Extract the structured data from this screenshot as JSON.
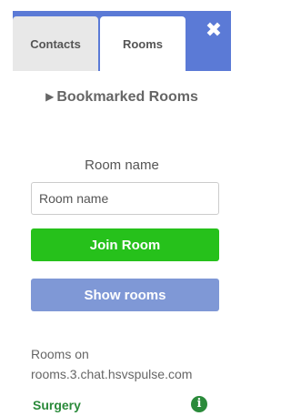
{
  "tabs": {
    "contacts_label": "Contacts",
    "rooms_label": "Rooms",
    "close_symbol": "✖"
  },
  "bookmarks": {
    "caret": "▶",
    "label": "Bookmarked Rooms"
  },
  "join_form": {
    "room_name_label": "Room name",
    "room_name_placeholder": "Room name",
    "room_name_value": "",
    "join_button_label": "Join Room",
    "show_rooms_label": "Show rooms"
  },
  "rooms_list": {
    "heading_line1": "Rooms on",
    "heading_line2": "rooms.3.chat.hsvspulse.com",
    "items": [
      {
        "name": "Surgery",
        "icon": "info-icon",
        "icon_glyph": "i"
      }
    ]
  },
  "colors": {
    "header_blue": "#5b7ad6",
    "join_green": "#26c11b",
    "show_blue": "#7f98d6",
    "room_green": "#2a8a3a"
  }
}
